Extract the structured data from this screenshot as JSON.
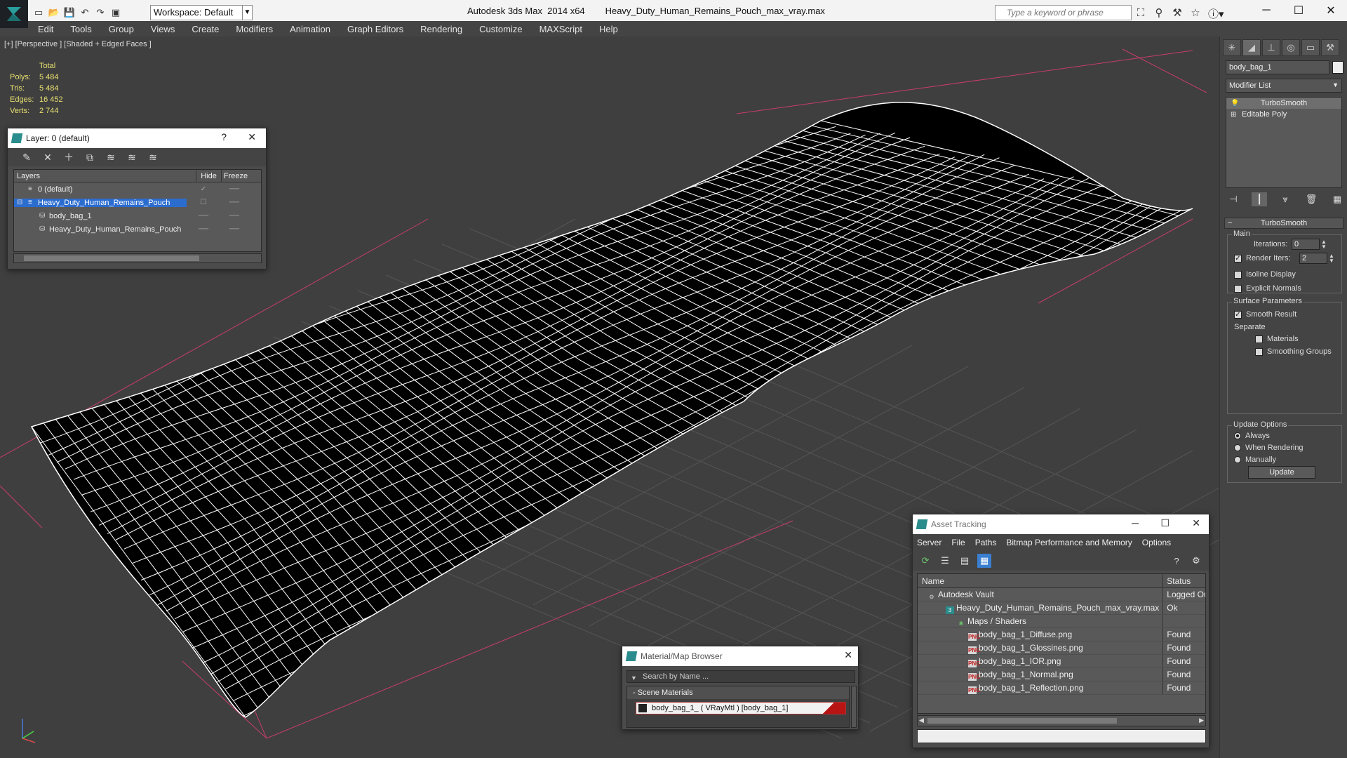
{
  "window": {
    "app_title": "Autodesk 3ds Max  2014 x64",
    "file_title": "Heavy_Duty_Human_Remains_Pouch_max_vray.max",
    "workspace_label": "Workspace: Default",
    "search_placeholder": "Type a keyword or phrase"
  },
  "menu": [
    "Edit",
    "Tools",
    "Group",
    "Views",
    "Create",
    "Modifiers",
    "Animation",
    "Graph Editors",
    "Rendering",
    "Customize",
    "MAXScript",
    "Help"
  ],
  "viewport": {
    "label": "[+] [Perspective ] [Shaded + Edged Faces ]",
    "stats": {
      "total_label": "Total",
      "rows": [
        {
          "label": "Polys:",
          "value": "5 484"
        },
        {
          "label": "Tris:",
          "value": "5 484"
        },
        {
          "label": "Edges:",
          "value": "16 452"
        },
        {
          "label": "Verts:",
          "value": "2 744"
        }
      ]
    }
  },
  "command_panel": {
    "object_name": "body_bag_1",
    "modifier_list": "Modifier List",
    "stack": [
      "TurboSmooth",
      "Editable Poly"
    ],
    "rollout_title": "TurboSmooth",
    "main_group": "Main",
    "iterations_label": "Iterations:",
    "iterations_value": "0",
    "render_iters_label": "Render Iters:",
    "render_iters_value": "2",
    "isoline_label": "Isoline Display",
    "explicit_normals_label": "Explicit Normals",
    "surface_group": "Surface Parameters",
    "smooth_result_label": "Smooth Result",
    "separate_label": "Separate",
    "materials_label": "Materials",
    "smoothing_groups_label": "Smoothing Groups",
    "update_group": "Update Options",
    "always_label": "Always",
    "when_rendering_label": "When Rendering",
    "manually_label": "Manually",
    "update_button": "Update"
  },
  "layer_dialog": {
    "title": "Layer: 0 (default)",
    "help": "?",
    "col_layers": "Layers",
    "col_hide": "Hide",
    "col_freeze": "Freeze",
    "rows": [
      {
        "name": "0 (default)",
        "hide": "✓",
        "freeze": "──"
      },
      {
        "name": "Heavy_Duty_Human_Remains_Pouch",
        "hide": "☐",
        "freeze": "──"
      },
      {
        "name": "body_bag_1",
        "hide": "──",
        "freeze": "──"
      },
      {
        "name": "Heavy_Duty_Human_Remains_Pouch",
        "hide": "──",
        "freeze": "──"
      }
    ]
  },
  "asset_dialog": {
    "title": "Asset Tracking",
    "menu": [
      "Server",
      "File",
      "Paths",
      "Bitmap Performance and Memory",
      "Options"
    ],
    "col_name": "Name",
    "col_status": "Status",
    "rows": [
      {
        "name": "Autodesk Vault",
        "status": "Logged Ou",
        "indent": 14,
        "icon": "vault"
      },
      {
        "name": "Heavy_Duty_Human_Remains_Pouch_max_vray.max",
        "status": "Ok",
        "indent": 40,
        "icon": "max"
      },
      {
        "name": "Maps / Shaders",
        "status": "",
        "indent": 56,
        "icon": "maps"
      },
      {
        "name": "body_bag_1_Diffuse.png",
        "status": "Found",
        "indent": 72,
        "icon": "png"
      },
      {
        "name": "body_bag_1_Glossines.png",
        "status": "Found",
        "indent": 72,
        "icon": "png"
      },
      {
        "name": "body_bag_1_IOR.png",
        "status": "Found",
        "indent": 72,
        "icon": "png"
      },
      {
        "name": "body_bag_1_Normal.png",
        "status": "Found",
        "indent": 72,
        "icon": "png"
      },
      {
        "name": "body_bag_1_Reflection.png",
        "status": "Found",
        "indent": 72,
        "icon": "png"
      }
    ]
  },
  "material_dialog": {
    "title": "Material/Map Browser",
    "search_placeholder": "Search by Name ...",
    "group": "- Scene Materials",
    "item": "body_bag_1_  ( VRayMtl ) [body_bag_1]"
  },
  "colors": {
    "accent_blue": "#2b6ccf",
    "stats_yellow": "#e8e070",
    "grid_red": "#c83c6e",
    "wire_white": "#ffffff"
  }
}
